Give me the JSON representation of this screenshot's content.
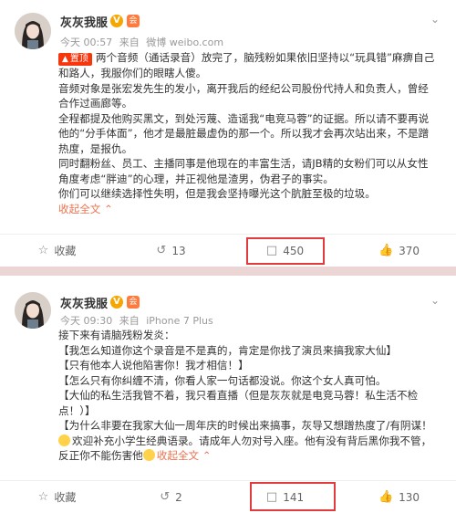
{
  "posts": [
    {
      "username": "灰灰我服",
      "badge_v": "V",
      "badge_member": "会",
      "time": "今天 00:57",
      "source_prefix": "来自",
      "source": "微博 weibo.com",
      "tag": "置顶",
      "lines": [
        "两个音频（通话录音）放完了，脑残粉如果依旧坚持以“玩具错”麻痹自己和路人，我服你们的眼瞎人傻。",
        "音频对象是张宏发先生的发小，离开我后的经纪公司股份代持人和负责人，曾经合作过画廊等。",
        "全程都提及他购买黑文，到处污蔑、造谣我“电竞马蓉”的证据。所以请不要再说他的“分手体面”，他才是最脏最虚伪的那一个。所以我才会再次站出来，不是蹭热度，是报仇。",
        "同时翻粉丝、员工、主播同事是他现在的丰富生活，请JB精的女粉们可以从女性角度考虑“胖迪”的心理，并正视他是渣男，伪君子的事实。",
        "你们可以继续选择性失明，但是我会坚持曝光这个肮脏至极的垃圾。"
      ],
      "collapse": "收起全文",
      "actions": {
        "fav": "收藏",
        "repost": "13",
        "comment": "450",
        "like": "370"
      }
    },
    {
      "username": "灰灰我服",
      "badge_v": "V",
      "badge_member": "会",
      "time": "今天 09:30",
      "source_prefix": "来自",
      "source": "iPhone 7 Plus",
      "intro": "接下来有请脑残粉发炎：",
      "quotes": [
        "【我怎么知道你这个录音是不是真的，肯定是你找了演员来搞我家大仙】",
        "【只有他本人说他陷害你！我才相信！】",
        "【怎么只有你纠缠不清，你看人家一句话都没说。你这个女人真可怕。",
        "【大仙的私生活我管不着，我只看直播（但是灰灰就是电竞马蓉！私生活不检点！）】",
        "【为什么非要在我家大仙一周年庆的时候出来搞事，灰导又想蹭热度了/有阴谋！",
        "欢迎补充小学生经典语录。请成年人勿对号入座。他有没有背后黑你我不管，反正你不能伤害他"
      ],
      "collapse": "收起全文",
      "actions": {
        "fav": "收藏",
        "repost": "2",
        "comment": "141",
        "like": "130"
      }
    }
  ],
  "icons": {
    "fav": "star-icon",
    "repost": "repost-icon",
    "comment": "comment-icon",
    "like": "thumbs-up-icon",
    "more": "chevron-down-icon"
  },
  "colors": {
    "highlight": "#e23b3b",
    "tag": "#f6360d",
    "link": "#eb7350",
    "badge_v": "#f7a600"
  }
}
